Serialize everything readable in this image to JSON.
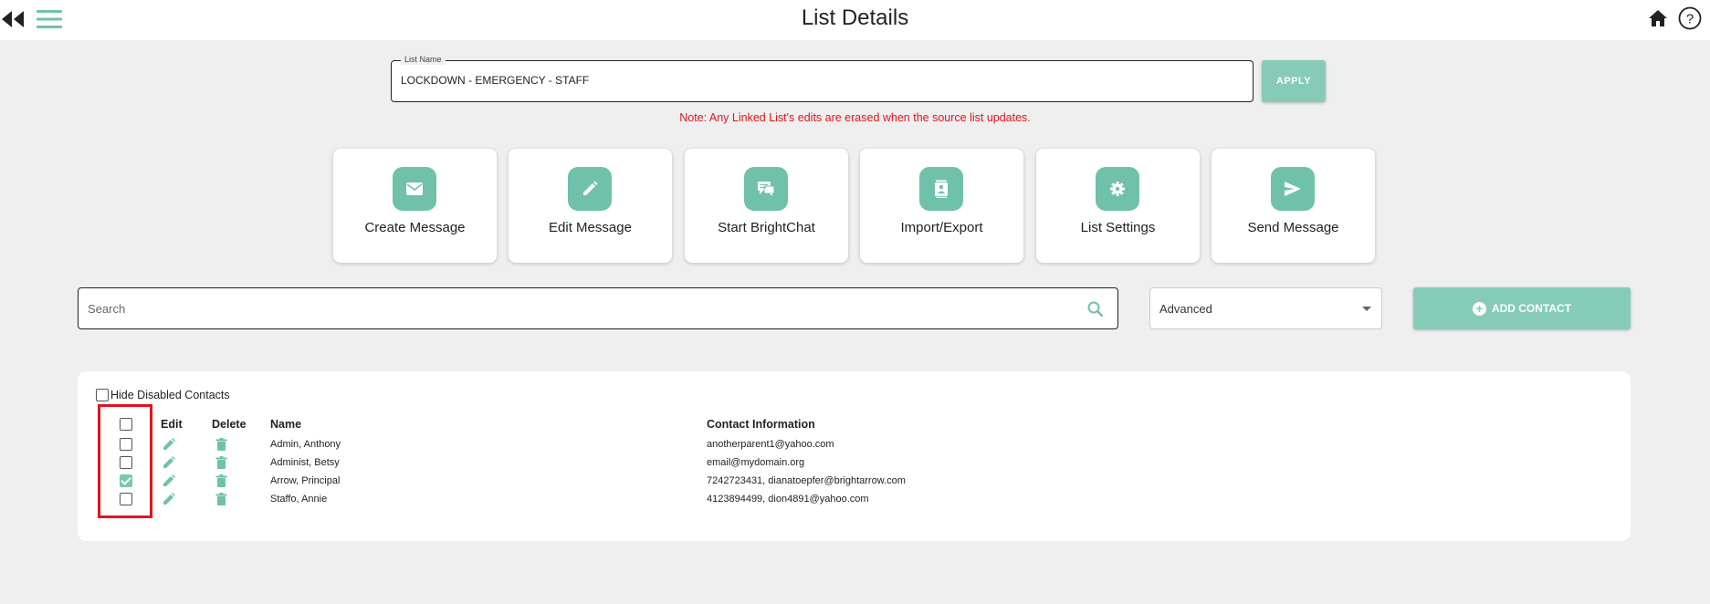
{
  "header": {
    "title": "List Details"
  },
  "list_name": {
    "legend": "List Name",
    "value": "LOCKDOWN - EMERGENCY - STAFF",
    "apply_label": "APPLY"
  },
  "note": "Note: Any Linked List's edits are erased when the source list updates.",
  "actions": [
    {
      "label": "Create Message",
      "icon": "envelope-icon"
    },
    {
      "label": "Edit Message",
      "icon": "pencil-icon"
    },
    {
      "label": "Start BrightChat",
      "icon": "chat-bubbles-icon"
    },
    {
      "label": "Import/Export",
      "icon": "contact-card-icon"
    },
    {
      "label": "List Settings",
      "icon": "gear-icon"
    },
    {
      "label": "Send Message",
      "icon": "send-icon"
    }
  ],
  "search": {
    "placeholder": "Search"
  },
  "advanced": {
    "selected": "Advanced"
  },
  "add_contact_label": "ADD CONTACT",
  "hide_disabled": {
    "label": "Hide Disabled Contacts",
    "checked": false
  },
  "table": {
    "columns": [
      "Edit",
      "Delete",
      "Name",
      "Contact Information"
    ],
    "rows": [
      {
        "checked": false,
        "name": "Admin, Anthony",
        "contact": "anotherparent1@yahoo.com"
      },
      {
        "checked": false,
        "name": "Administ, Betsy",
        "contact": "email@mydomain.org"
      },
      {
        "checked": true,
        "name": "Arrow, Principal",
        "contact": "7242723431, dianatoepfer@brightarrow.com"
      },
      {
        "checked": false,
        "name": "Staffo, Annie",
        "contact": "4123894499, dion4891@yahoo.com"
      }
    ]
  },
  "colors": {
    "accent": "#6fc1aa",
    "button": "#86cbb7",
    "warning": "#e0141e"
  }
}
